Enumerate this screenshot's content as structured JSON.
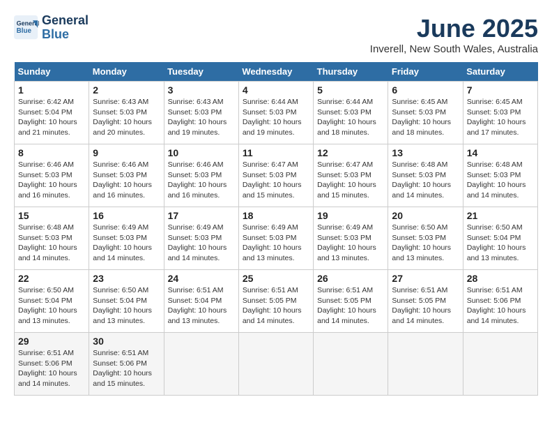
{
  "header": {
    "logo_line1": "General",
    "logo_line2": "Blue",
    "title": "June 2025",
    "subtitle": "Inverell, New South Wales, Australia"
  },
  "columns": [
    "Sunday",
    "Monday",
    "Tuesday",
    "Wednesday",
    "Thursday",
    "Friday",
    "Saturday"
  ],
  "weeks": [
    [
      {
        "day": "1",
        "sunrise": "6:42 AM",
        "sunset": "5:04 PM",
        "daylight": "10 hours and 21 minutes."
      },
      {
        "day": "2",
        "sunrise": "6:43 AM",
        "sunset": "5:03 PM",
        "daylight": "10 hours and 20 minutes."
      },
      {
        "day": "3",
        "sunrise": "6:43 AM",
        "sunset": "5:03 PM",
        "daylight": "10 hours and 19 minutes."
      },
      {
        "day": "4",
        "sunrise": "6:44 AM",
        "sunset": "5:03 PM",
        "daylight": "10 hours and 19 minutes."
      },
      {
        "day": "5",
        "sunrise": "6:44 AM",
        "sunset": "5:03 PM",
        "daylight": "10 hours and 18 minutes."
      },
      {
        "day": "6",
        "sunrise": "6:45 AM",
        "sunset": "5:03 PM",
        "daylight": "10 hours and 18 minutes."
      },
      {
        "day": "7",
        "sunrise": "6:45 AM",
        "sunset": "5:03 PM",
        "daylight": "10 hours and 17 minutes."
      }
    ],
    [
      {
        "day": "8",
        "sunrise": "6:46 AM",
        "sunset": "5:03 PM",
        "daylight": "10 hours and 16 minutes."
      },
      {
        "day": "9",
        "sunrise": "6:46 AM",
        "sunset": "5:03 PM",
        "daylight": "10 hours and 16 minutes."
      },
      {
        "day": "10",
        "sunrise": "6:46 AM",
        "sunset": "5:03 PM",
        "daylight": "10 hours and 16 minutes."
      },
      {
        "day": "11",
        "sunrise": "6:47 AM",
        "sunset": "5:03 PM",
        "daylight": "10 hours and 15 minutes."
      },
      {
        "day": "12",
        "sunrise": "6:47 AM",
        "sunset": "5:03 PM",
        "daylight": "10 hours and 15 minutes."
      },
      {
        "day": "13",
        "sunrise": "6:48 AM",
        "sunset": "5:03 PM",
        "daylight": "10 hours and 14 minutes."
      },
      {
        "day": "14",
        "sunrise": "6:48 AM",
        "sunset": "5:03 PM",
        "daylight": "10 hours and 14 minutes."
      }
    ],
    [
      {
        "day": "15",
        "sunrise": "6:48 AM",
        "sunset": "5:03 PM",
        "daylight": "10 hours and 14 minutes."
      },
      {
        "day": "16",
        "sunrise": "6:49 AM",
        "sunset": "5:03 PM",
        "daylight": "10 hours and 14 minutes."
      },
      {
        "day": "17",
        "sunrise": "6:49 AM",
        "sunset": "5:03 PM",
        "daylight": "10 hours and 14 minutes."
      },
      {
        "day": "18",
        "sunrise": "6:49 AM",
        "sunset": "5:03 PM",
        "daylight": "10 hours and 13 minutes."
      },
      {
        "day": "19",
        "sunrise": "6:49 AM",
        "sunset": "5:03 PM",
        "daylight": "10 hours and 13 minutes."
      },
      {
        "day": "20",
        "sunrise": "6:50 AM",
        "sunset": "5:03 PM",
        "daylight": "10 hours and 13 minutes."
      },
      {
        "day": "21",
        "sunrise": "6:50 AM",
        "sunset": "5:04 PM",
        "daylight": "10 hours and 13 minutes."
      }
    ],
    [
      {
        "day": "22",
        "sunrise": "6:50 AM",
        "sunset": "5:04 PM",
        "daylight": "10 hours and 13 minutes."
      },
      {
        "day": "23",
        "sunrise": "6:50 AM",
        "sunset": "5:04 PM",
        "daylight": "10 hours and 13 minutes."
      },
      {
        "day": "24",
        "sunrise": "6:51 AM",
        "sunset": "5:04 PM",
        "daylight": "10 hours and 13 minutes."
      },
      {
        "day": "25",
        "sunrise": "6:51 AM",
        "sunset": "5:05 PM",
        "daylight": "10 hours and 14 minutes."
      },
      {
        "day": "26",
        "sunrise": "6:51 AM",
        "sunset": "5:05 PM",
        "daylight": "10 hours and 14 minutes."
      },
      {
        "day": "27",
        "sunrise": "6:51 AM",
        "sunset": "5:05 PM",
        "daylight": "10 hours and 14 minutes."
      },
      {
        "day": "28",
        "sunrise": "6:51 AM",
        "sunset": "5:06 PM",
        "daylight": "10 hours and 14 minutes."
      }
    ],
    [
      {
        "day": "29",
        "sunrise": "6:51 AM",
        "sunset": "5:06 PM",
        "daylight": "10 hours and 14 minutes."
      },
      {
        "day": "30",
        "sunrise": "6:51 AM",
        "sunset": "5:06 PM",
        "daylight": "10 hours and 15 minutes."
      },
      null,
      null,
      null,
      null,
      null
    ]
  ]
}
